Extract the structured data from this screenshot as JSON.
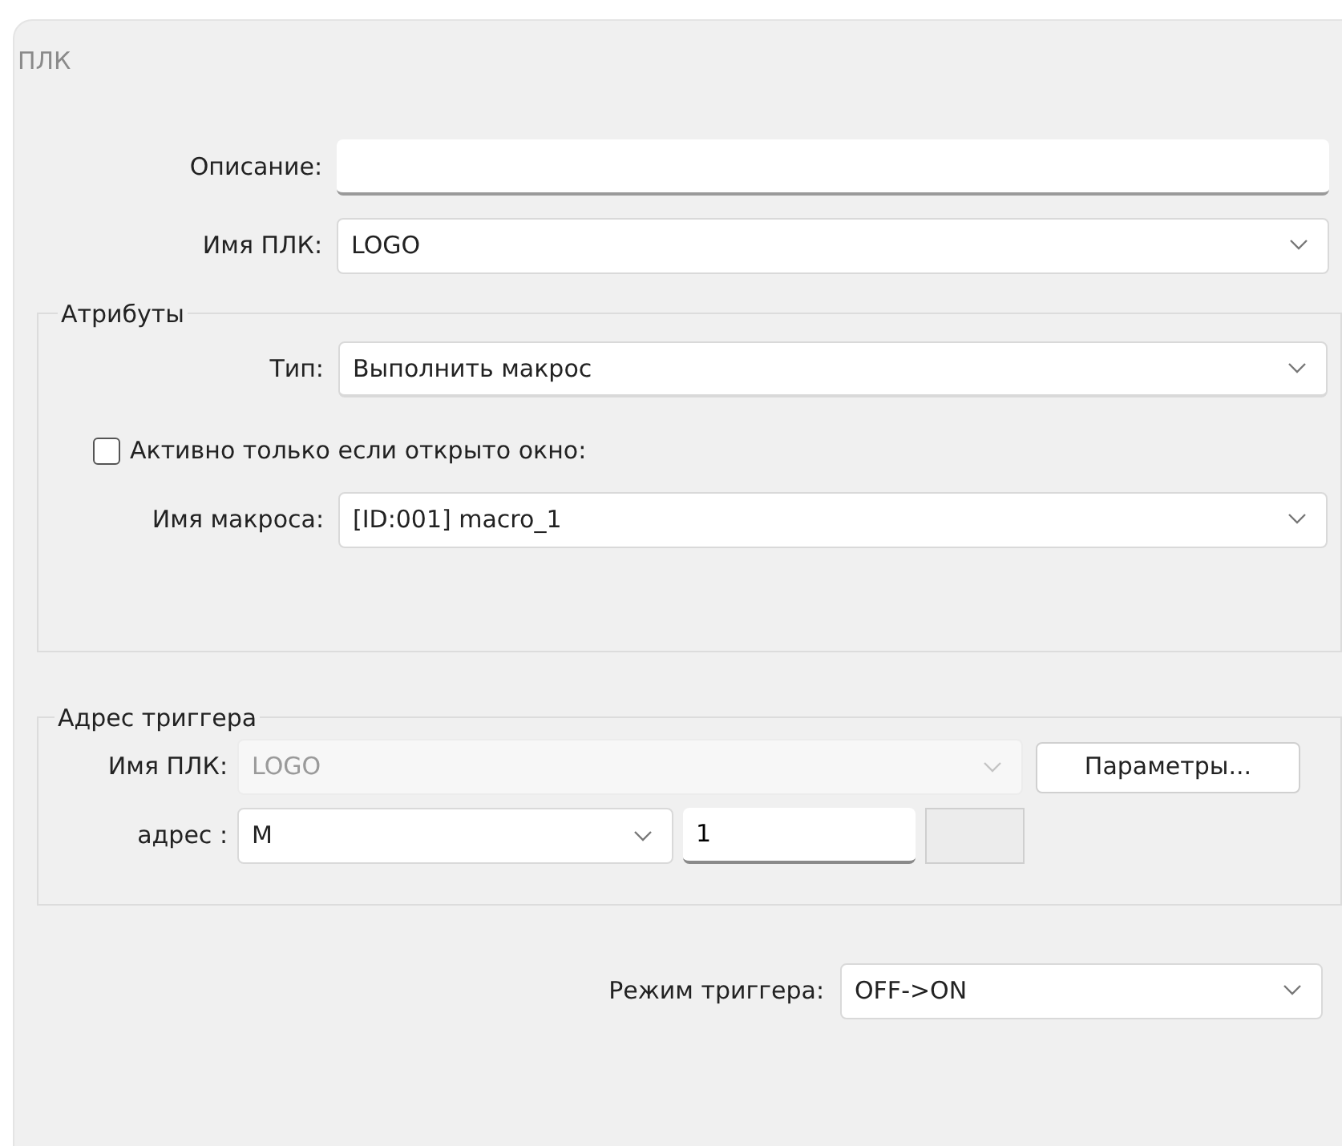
{
  "window": {
    "title": "ПЛК"
  },
  "fields": [
    {
      "label": "Описание:",
      "kind": "text"
    },
    {
      "label": "Имя ПЛК:",
      "kind": "select",
      "value": "LOGO"
    }
  ],
  "attributes": {
    "title": "Атрибуты",
    "type": {
      "label": "Тип:",
      "value": "Выполнить макрос"
    },
    "only_if_window_open": {
      "label": "Активно только если открыто окно:",
      "checked": false
    },
    "macro": {
      "label": "Имя макроса:",
      "value": "[ID:001] macro_1"
    }
  },
  "trigger_address": {
    "title": "Адрес триггера",
    "plc": {
      "label": "Имя ПЛК:",
      "value": "LOGO",
      "disabled": true
    },
    "params_button": "Параметры...",
    "address": {
      "label": "адрес :",
      "device": "M",
      "number": "1"
    }
  },
  "trigger_mode": {
    "label": "Режим триггера:",
    "value": "OFF->ON"
  }
}
